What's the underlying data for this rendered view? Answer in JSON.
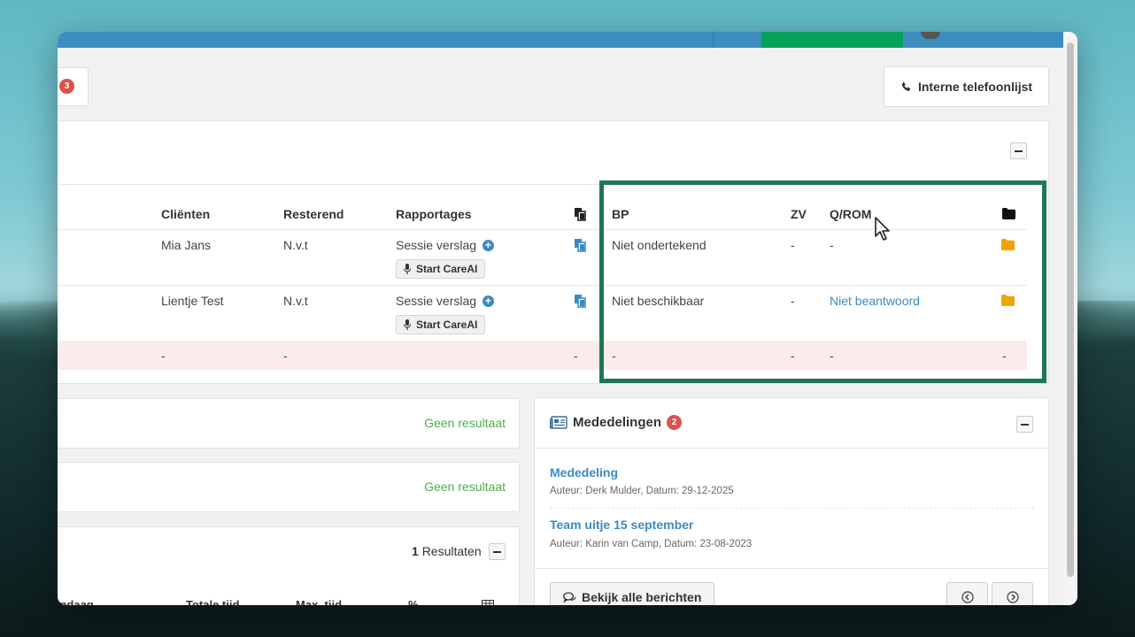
{
  "toolbar": {
    "notification_count": "3",
    "phone_button": "Interne telefoonlijst"
  },
  "table": {
    "headers": [
      "Cliënten",
      "Resterend",
      "Rapportages",
      "BP",
      "ZV",
      "Q/ROM"
    ],
    "rows": [
      {
        "client": "Mia Jans",
        "resterend": "N.v.t",
        "rapportage": "Sessie verslag",
        "careai": "Start CareAI",
        "bp": "Niet ondertekend",
        "zv": "-",
        "qrom": "-"
      },
      {
        "client": "Lientje Test",
        "resterend": "N.v.t",
        "rapportage": "Sessie verslag",
        "careai": "Start CareAI",
        "bp": "Niet beschikbaar",
        "zv": "-",
        "qrom": "Niet beantwoord"
      },
      {
        "client": "-",
        "resterend": "-",
        "rapportage_dash": "-",
        "bp": "-",
        "zv": "-",
        "qrom": "-",
        "folder": "-"
      }
    ]
  },
  "panels": {
    "no_result_1": "Geen resultaat",
    "no_result_2": "Geen resultaat",
    "results_count": "1",
    "results_label": "Resultaten",
    "bottom_headers": [
      "vandaag",
      "Totale tijd",
      "Max. tijd",
      "%"
    ]
  },
  "mededelingen": {
    "title": "Mededelingen",
    "count": "2",
    "items": [
      {
        "title": "Mededeling",
        "meta": "Auteur: Derk Mulder, Datum: 29-12-2025"
      },
      {
        "title": "Team uitje 15 september",
        "meta": "Auteur: Karin van Camp, Datum: 23-08-2023"
      }
    ],
    "view_all": "Bekijk alle berichten"
  },
  "colors": {
    "topbar": "#3d8dbf",
    "green": "#04a25b",
    "highlight": "#1f7657",
    "link": "#3a8bc4",
    "success": "#4cae4c",
    "badge": "#d9534f",
    "folder": "#f0a30a"
  }
}
